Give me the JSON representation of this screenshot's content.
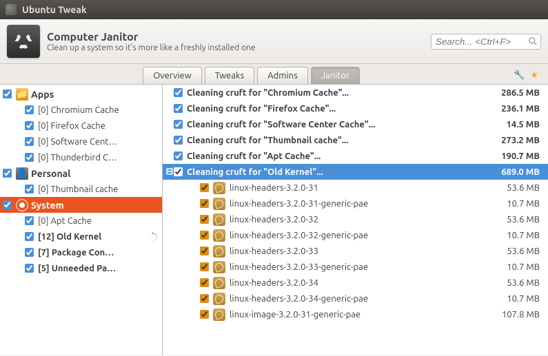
{
  "window": {
    "title": "Ubuntu Tweak"
  },
  "header": {
    "title": "Computer Janitor",
    "subtitle": "Clean up a system so it's more like a freshly installed one",
    "search_placeholder": "Search... <Ctrl+F>"
  },
  "tabs": {
    "overview": "Overview",
    "tweaks": "Tweaks",
    "admins": "Admins",
    "janitor": "Janitor"
  },
  "sidebar": {
    "apps": {
      "label": "Apps",
      "items": [
        "[0] Chromium Cache",
        "[0] Firefox Cache",
        "[0] Software Cent…",
        "[0] Thunderbird C…"
      ]
    },
    "personal": {
      "label": "Personal",
      "items": [
        "[0] Thumbnail cache"
      ]
    },
    "system": {
      "label": "System",
      "items": [
        {
          "label": "[0] Apt Cache",
          "bold": false,
          "spinner": false
        },
        {
          "label": "[12] Old Kernel",
          "bold": true,
          "spinner": true
        },
        {
          "label": "[7] Package Con…",
          "bold": true,
          "spinner": false
        },
        {
          "label": "[5] Unneeded Pa…",
          "bold": true,
          "spinner": false
        }
      ]
    }
  },
  "results": {
    "headers": [
      {
        "label": "Cleaning cruft for \"Chromium Cache\"...",
        "size": "286.5 MB"
      },
      {
        "label": "Cleaning cruft for \"Firefox Cache\"...",
        "size": "236.1 MB"
      },
      {
        "label": "Cleaning cruft for \"Software Center Cache\"...",
        "size": "14.5 MB"
      },
      {
        "label": "Cleaning cruft for \"Thumbnail cache\"...",
        "size": "273.2 MB"
      },
      {
        "label": "Cleaning cruft for \"Apt Cache\"...",
        "size": "190.7 MB"
      }
    ],
    "selected": {
      "label": "Cleaning cruft for \"Old Kernel\"...",
      "size": "689.0 MB"
    },
    "packages": [
      {
        "name": "linux-headers-3.2.0-31",
        "size": "53.6 MB"
      },
      {
        "name": "linux-headers-3.2.0-31-generic-pae",
        "size": "10.7 MB"
      },
      {
        "name": "linux-headers-3.2.0-32",
        "size": "53.6 MB"
      },
      {
        "name": "linux-headers-3.2.0-32-generic-pae",
        "size": "10.7 MB"
      },
      {
        "name": "linux-headers-3.2.0-33",
        "size": "53.6 MB"
      },
      {
        "name": "linux-headers-3.2.0-33-generic-pae",
        "size": "10.7 MB"
      },
      {
        "name": "linux-headers-3.2.0-34",
        "size": "53.6 MB"
      },
      {
        "name": "linux-headers-3.2.0-34-generic-pae",
        "size": "10.7 MB"
      },
      {
        "name": "linux-image-3.2.0-31-generic-pae",
        "size": "107.8 MB"
      }
    ]
  }
}
